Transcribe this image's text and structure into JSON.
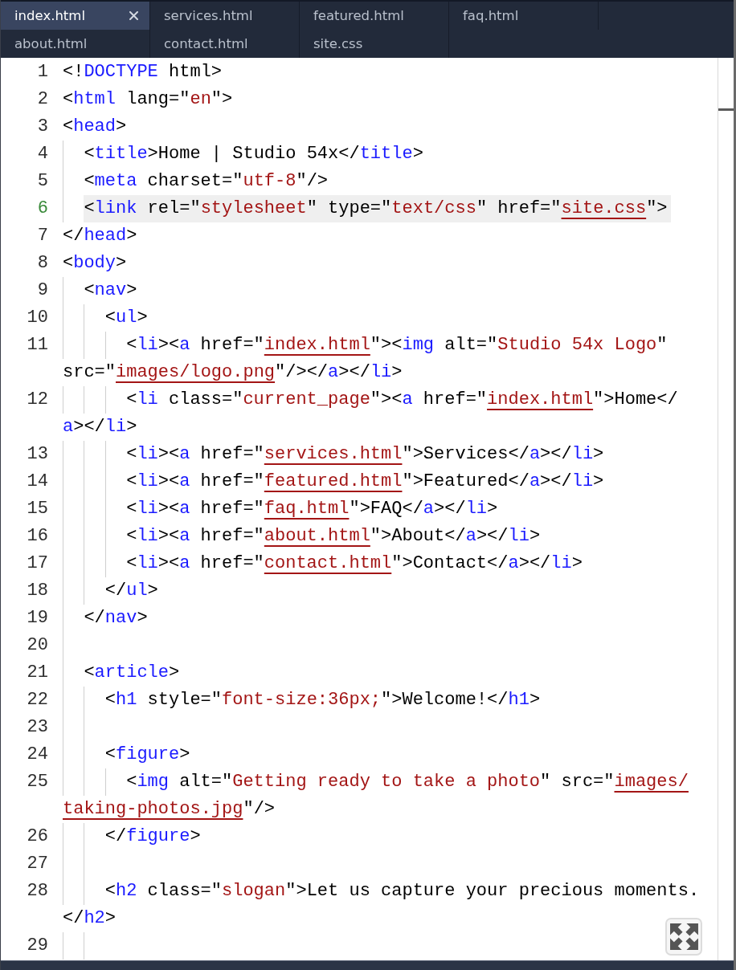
{
  "tabs": [
    {
      "label": "index.html",
      "selected": true
    },
    {
      "label": "services.html",
      "selected": false
    },
    {
      "label": "featured.html",
      "selected": false
    },
    {
      "label": "faq.html",
      "selected": false
    },
    {
      "label": "about.html",
      "selected": false
    },
    {
      "label": "contact.html",
      "selected": false
    },
    {
      "label": "site.css",
      "selected": false
    }
  ],
  "lines": [
    {
      "number": "1",
      "current": false,
      "parts": [
        {
          "tokens": [
            {
              "kind": "plain",
              "text": "<!"
            },
            {
              "kind": "tag",
              "text": "DOCTYPE"
            },
            {
              "kind": "plain",
              "text": " html>"
            }
          ]
        }
      ]
    },
    {
      "number": "2",
      "current": false,
      "parts": [
        {
          "tokens": [
            {
              "kind": "plain",
              "text": "<"
            },
            {
              "kind": "tag",
              "text": "html"
            },
            {
              "kind": "plain",
              "text": " lang=\""
            },
            {
              "kind": "string",
              "text": "en"
            },
            {
              "kind": "plain",
              "text": "\">"
            }
          ]
        }
      ]
    },
    {
      "number": "3",
      "current": false,
      "parts": [
        {
          "tokens": [
            {
              "kind": "plain",
              "text": "<"
            },
            {
              "kind": "tag",
              "text": "head"
            },
            {
              "kind": "plain",
              "text": ">"
            }
          ]
        }
      ],
      "children": [
        {
          "number": "4",
          "current": false,
          "parts": [
            {
              "tokens": [
                {
                  "kind": "plain",
                  "text": "<"
                },
                {
                  "kind": "tag",
                  "text": "title"
                },
                {
                  "kind": "plain",
                  "text": ">Home | Studio 54x</"
                },
                {
                  "kind": "tag",
                  "text": "title"
                },
                {
                  "kind": "plain",
                  "text": ">"
                }
              ]
            }
          ]
        },
        {
          "number": "5",
          "current": false,
          "parts": [
            {
              "tokens": [
                {
                  "kind": "plain",
                  "text": "<"
                },
                {
                  "kind": "tag",
                  "text": "meta"
                },
                {
                  "kind": "plain",
                  "text": " charset=\""
                },
                {
                  "kind": "string",
                  "text": "utf-8"
                },
                {
                  "kind": "plain",
                  "text": "\"/>"
                }
              ]
            }
          ]
        },
        {
          "number": "6",
          "current": true,
          "parts": [
            {
              "tokens": [
                {
                  "kind": "plain",
                  "text": "<"
                },
                {
                  "kind": "tag",
                  "text": "link"
                },
                {
                  "kind": "plain",
                  "text": " rel=\""
                },
                {
                  "kind": "string",
                  "text": "stylesheet"
                },
                {
                  "kind": "plain",
                  "text": "\" type=\""
                },
                {
                  "kind": "string",
                  "text": "text/css"
                },
                {
                  "kind": "plain",
                  "text": "\" href=\""
                },
                {
                  "kind": "link",
                  "text": "site.css"
                },
                {
                  "kind": "plain",
                  "text": "\">"
                }
              ]
            }
          ]
        }
      ]
    },
    {
      "number": "7",
      "current": false,
      "parts": [
        {
          "tokens": [
            {
              "kind": "plain",
              "text": "</"
            },
            {
              "kind": "tag",
              "text": "head"
            },
            {
              "kind": "plain",
              "text": ">"
            }
          ]
        }
      ]
    },
    {
      "number": "8",
      "current": false,
      "parts": [
        {
          "tokens": [
            {
              "kind": "plain",
              "text": "<"
            },
            {
              "kind": "tag",
              "text": "body"
            },
            {
              "kind": "plain",
              "text": ">"
            }
          ]
        }
      ],
      "children": [
        {
          "number": "9",
          "current": false,
          "parts": [
            {
              "tokens": [
                {
                  "kind": "plain",
                  "text": "<"
                },
                {
                  "kind": "tag",
                  "text": "nav"
                },
                {
                  "kind": "plain",
                  "text": ">"
                }
              ]
            }
          ],
          "children": [
            {
              "number": "10",
              "current": false,
              "parts": [
                {
                  "tokens": [
                    {
                      "kind": "plain",
                      "text": "<"
                    },
                    {
                      "kind": "tag",
                      "text": "ul"
                    },
                    {
                      "kind": "plain",
                      "text": ">"
                    }
                  ]
                }
              ],
              "children": [
                {
                  "number": "11",
                  "current": false,
                  "parts": [
                    {
                      "tokens": [
                        {
                          "kind": "plain",
                          "text": "<"
                        },
                        {
                          "kind": "tag",
                          "text": "li"
                        },
                        {
                          "kind": "plain",
                          "text": "><"
                        },
                        {
                          "kind": "tag",
                          "text": "a"
                        },
                        {
                          "kind": "plain",
                          "text": " href=\""
                        },
                        {
                          "kind": "link",
                          "text": "index.html"
                        },
                        {
                          "kind": "plain",
                          "text": "\"><"
                        },
                        {
                          "kind": "tag",
                          "text": "img"
                        },
                        {
                          "kind": "plain",
                          "text": " alt=\""
                        },
                        {
                          "kind": "string",
                          "text": "Studio 54x Logo"
                        },
                        {
                          "kind": "plain",
                          "text": "\""
                        }
                      ]
                    },
                    {
                      "tokens": [
                        {
                          "kind": "plain",
                          "text": "src=\""
                        },
                        {
                          "kind": "link",
                          "text": "images/logo.png"
                        },
                        {
                          "kind": "plain",
                          "text": "\"/></"
                        },
                        {
                          "kind": "tag",
                          "text": "a"
                        },
                        {
                          "kind": "plain",
                          "text": "></"
                        },
                        {
                          "kind": "tag",
                          "text": "li"
                        },
                        {
                          "kind": "plain",
                          "text": ">"
                        }
                      ]
                    }
                  ]
                },
                {
                  "number": "12",
                  "current": false,
                  "parts": [
                    {
                      "tokens": [
                        {
                          "kind": "plain",
                          "text": "<"
                        },
                        {
                          "kind": "tag",
                          "text": "li"
                        },
                        {
                          "kind": "plain",
                          "text": " class=\""
                        },
                        {
                          "kind": "string",
                          "text": "current_page"
                        },
                        {
                          "kind": "plain",
                          "text": "\"><"
                        },
                        {
                          "kind": "tag",
                          "text": "a"
                        },
                        {
                          "kind": "plain",
                          "text": " href=\""
                        },
                        {
                          "kind": "link",
                          "text": "index.html"
                        },
                        {
                          "kind": "plain",
                          "text": "\">Home</"
                        }
                      ]
                    },
                    {
                      "tokens": [
                        {
                          "kind": "tag",
                          "text": "a"
                        },
                        {
                          "kind": "plain",
                          "text": "></"
                        },
                        {
                          "kind": "tag",
                          "text": "li"
                        },
                        {
                          "kind": "plain",
                          "text": ">"
                        }
                      ]
                    }
                  ]
                },
                {
                  "number": "13",
                  "current": false,
                  "parts": [
                    {
                      "tokens": [
                        {
                          "kind": "plain",
                          "text": "<"
                        },
                        {
                          "kind": "tag",
                          "text": "li"
                        },
                        {
                          "kind": "plain",
                          "text": "><"
                        },
                        {
                          "kind": "tag",
                          "text": "a"
                        },
                        {
                          "kind": "plain",
                          "text": " href=\""
                        },
                        {
                          "kind": "link",
                          "text": "services.html"
                        },
                        {
                          "kind": "plain",
                          "text": "\">Services</"
                        },
                        {
                          "kind": "tag",
                          "text": "a"
                        },
                        {
                          "kind": "plain",
                          "text": "></"
                        },
                        {
                          "kind": "tag",
                          "text": "li"
                        },
                        {
                          "kind": "plain",
                          "text": ">"
                        }
                      ]
                    }
                  ]
                },
                {
                  "number": "14",
                  "current": false,
                  "parts": [
                    {
                      "tokens": [
                        {
                          "kind": "plain",
                          "text": "<"
                        },
                        {
                          "kind": "tag",
                          "text": "li"
                        },
                        {
                          "kind": "plain",
                          "text": "><"
                        },
                        {
                          "kind": "tag",
                          "text": "a"
                        },
                        {
                          "kind": "plain",
                          "text": " href=\""
                        },
                        {
                          "kind": "link",
                          "text": "featured.html"
                        },
                        {
                          "kind": "plain",
                          "text": "\">Featured</"
                        },
                        {
                          "kind": "tag",
                          "text": "a"
                        },
                        {
                          "kind": "plain",
                          "text": "></"
                        },
                        {
                          "kind": "tag",
                          "text": "li"
                        },
                        {
                          "kind": "plain",
                          "text": ">"
                        }
                      ]
                    }
                  ]
                },
                {
                  "number": "15",
                  "current": false,
                  "parts": [
                    {
                      "tokens": [
                        {
                          "kind": "plain",
                          "text": "<"
                        },
                        {
                          "kind": "tag",
                          "text": "li"
                        },
                        {
                          "kind": "plain",
                          "text": "><"
                        },
                        {
                          "kind": "tag",
                          "text": "a"
                        },
                        {
                          "kind": "plain",
                          "text": " href=\""
                        },
                        {
                          "kind": "link",
                          "text": "faq.html"
                        },
                        {
                          "kind": "plain",
                          "text": "\">FAQ</"
                        },
                        {
                          "kind": "tag",
                          "text": "a"
                        },
                        {
                          "kind": "plain",
                          "text": "></"
                        },
                        {
                          "kind": "tag",
                          "text": "li"
                        },
                        {
                          "kind": "plain",
                          "text": ">"
                        }
                      ]
                    }
                  ]
                },
                {
                  "number": "16",
                  "current": false,
                  "parts": [
                    {
                      "tokens": [
                        {
                          "kind": "plain",
                          "text": "<"
                        },
                        {
                          "kind": "tag",
                          "text": "li"
                        },
                        {
                          "kind": "plain",
                          "text": "><"
                        },
                        {
                          "kind": "tag",
                          "text": "a"
                        },
                        {
                          "kind": "plain",
                          "text": " href=\""
                        },
                        {
                          "kind": "link",
                          "text": "about.html"
                        },
                        {
                          "kind": "plain",
                          "text": "\">About</"
                        },
                        {
                          "kind": "tag",
                          "text": "a"
                        },
                        {
                          "kind": "plain",
                          "text": "></"
                        },
                        {
                          "kind": "tag",
                          "text": "li"
                        },
                        {
                          "kind": "plain",
                          "text": ">"
                        }
                      ]
                    }
                  ]
                },
                {
                  "number": "17",
                  "current": false,
                  "parts": [
                    {
                      "tokens": [
                        {
                          "kind": "plain",
                          "text": "<"
                        },
                        {
                          "kind": "tag",
                          "text": "li"
                        },
                        {
                          "kind": "plain",
                          "text": "><"
                        },
                        {
                          "kind": "tag",
                          "text": "a"
                        },
                        {
                          "kind": "plain",
                          "text": " href=\""
                        },
                        {
                          "kind": "link",
                          "text": "contact.html"
                        },
                        {
                          "kind": "plain",
                          "text": "\">Contact</"
                        },
                        {
                          "kind": "tag",
                          "text": "a"
                        },
                        {
                          "kind": "plain",
                          "text": "></"
                        },
                        {
                          "kind": "tag",
                          "text": "li"
                        },
                        {
                          "kind": "plain",
                          "text": ">"
                        }
                      ]
                    }
                  ]
                }
              ]
            },
            {
              "number": "18",
              "current": false,
              "parts": [
                {
                  "tokens": [
                    {
                      "kind": "plain",
                      "text": "</"
                    },
                    {
                      "kind": "tag",
                      "text": "ul"
                    },
                    {
                      "kind": "plain",
                      "text": ">"
                    }
                  ]
                }
              ]
            }
          ]
        },
        {
          "number": "19",
          "current": false,
          "parts": [
            {
              "tokens": [
                {
                  "kind": "plain",
                  "text": "</"
                },
                {
                  "kind": "tag",
                  "text": "nav"
                },
                {
                  "kind": "plain",
                  "text": ">"
                }
              ]
            }
          ]
        },
        {
          "number": "20",
          "current": false
        },
        {
          "number": "21",
          "current": false,
          "parts": [
            {
              "tokens": [
                {
                  "kind": "plain",
                  "text": "<"
                },
                {
                  "kind": "tag",
                  "text": "article"
                },
                {
                  "kind": "plain",
                  "text": ">"
                }
              ]
            }
          ],
          "children": [
            {
              "number": "22",
              "current": false,
              "parts": [
                {
                  "tokens": [
                    {
                      "kind": "plain",
                      "text": "<"
                    },
                    {
                      "kind": "tag",
                      "text": "h1"
                    },
                    {
                      "kind": "plain",
                      "text": " style=\""
                    },
                    {
                      "kind": "string",
                      "text": "font-size:36px;"
                    },
                    {
                      "kind": "plain",
                      "text": "\">Welcome!</"
                    },
                    {
                      "kind": "tag",
                      "text": "h1"
                    },
                    {
                      "kind": "plain",
                      "text": ">"
                    }
                  ]
                }
              ]
            },
            {
              "number": "23",
              "current": false
            },
            {
              "number": "24",
              "current": false,
              "parts": [
                {
                  "tokens": [
                    {
                      "kind": "plain",
                      "text": "<"
                    },
                    {
                      "kind": "tag",
                      "text": "figure"
                    },
                    {
                      "kind": "plain",
                      "text": ">"
                    }
                  ]
                }
              ],
              "children": [
                {
                  "number": "25",
                  "current": false,
                  "parts": [
                    {
                      "tokens": [
                        {
                          "kind": "plain",
                          "text": "<"
                        },
                        {
                          "kind": "tag",
                          "text": "img"
                        },
                        {
                          "kind": "plain",
                          "text": " alt=\""
                        },
                        {
                          "kind": "string",
                          "text": "Getting ready to take a photo"
                        },
                        {
                          "kind": "plain",
                          "text": "\" src=\""
                        },
                        {
                          "kind": "link",
                          "text": "images/"
                        }
                      ]
                    },
                    {
                      "tokens": [
                        {
                          "kind": "link",
                          "text": "taking-photos.jpg"
                        },
                        {
                          "kind": "plain",
                          "text": "\"/>"
                        }
                      ]
                    }
                  ]
                }
              ]
            },
            {
              "number": "26",
              "current": false,
              "parts": [
                {
                  "tokens": [
                    {
                      "kind": "plain",
                      "text": "</"
                    },
                    {
                      "kind": "tag",
                      "text": "figure"
                    },
                    {
                      "kind": "plain",
                      "text": ">"
                    }
                  ]
                }
              ]
            },
            {
              "number": "27",
              "current": false
            },
            {
              "number": "28",
              "current": false,
              "parts": [
                {
                  "tokens": [
                    {
                      "kind": "plain",
                      "text": "<"
                    },
                    {
                      "kind": "tag",
                      "text": "h2"
                    },
                    {
                      "kind": "plain",
                      "text": " class=\""
                    },
                    {
                      "kind": "string",
                      "text": "slogan"
                    },
                    {
                      "kind": "plain",
                      "text": "\">Let us capture your precious moments."
                    }
                  ]
                },
                {
                  "tokens": [
                    {
                      "kind": "plain",
                      "text": "</"
                    },
                    {
                      "kind": "tag",
                      "text": "h2"
                    },
                    {
                      "kind": "plain",
                      "text": ">"
                    }
                  ]
                }
              ]
            },
            {
              "number": "29",
              "current": false
            }
          ]
        }
      ]
    }
  ]
}
